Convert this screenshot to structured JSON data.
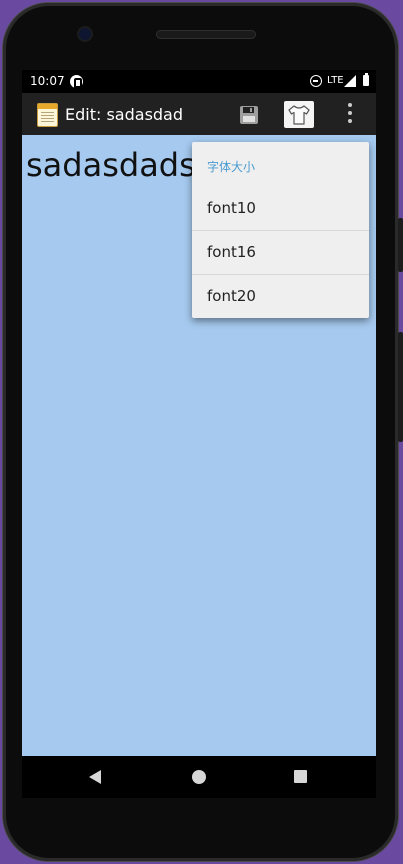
{
  "status_bar": {
    "time": "10:07",
    "network": "LTE"
  },
  "toolbar": {
    "title": "Edit: sadasdad",
    "icons": {
      "app": "notepad-icon",
      "save": "floppy-disk-icon",
      "theme": "tshirt-icon",
      "more": "overflow-menu-icon"
    }
  },
  "editor": {
    "text": "sadasdadsa"
  },
  "font_menu": {
    "header": "字体大小",
    "items": [
      "font10",
      "font16",
      "font20"
    ]
  },
  "colors": {
    "editor_background": "#a5c9ef",
    "toolbar_background": "#212121",
    "menu_header": "#4a9bd0",
    "menu_background": "#efefef"
  }
}
